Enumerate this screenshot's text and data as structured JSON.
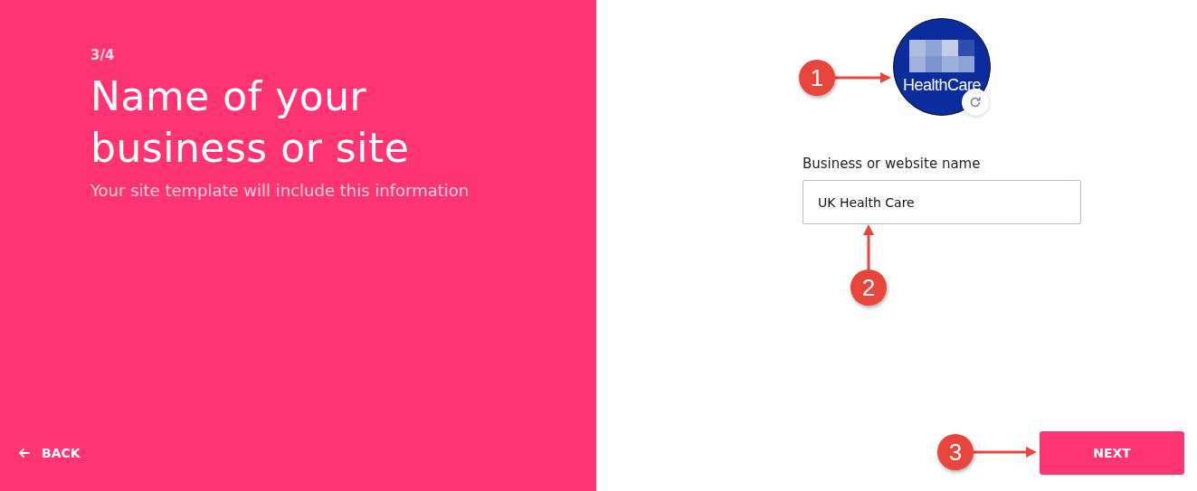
{
  "step": "3/4",
  "title": "Name of your business or site",
  "subtitle": "Your site template will include this information",
  "back_button": {
    "label": "BACK"
  },
  "logo": {
    "text": "HealthCare"
  },
  "name_field": {
    "label": "Business or website name",
    "value": "UK Health Care"
  },
  "next_button": {
    "label": "NEXT"
  },
  "annotations": [
    {
      "label": "1",
      "kind": "right"
    },
    {
      "label": "2",
      "kind": "up"
    },
    {
      "label": "3",
      "kind": "right"
    }
  ]
}
